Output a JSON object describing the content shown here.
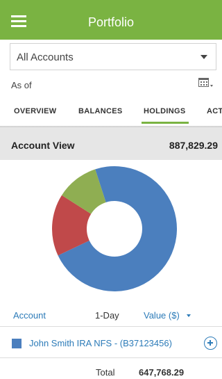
{
  "header": {
    "title": "Portfolio",
    "menu_icon": "hamburger-menu-icon"
  },
  "account_select": {
    "value": "All Accounts",
    "icon": "caret-down-icon"
  },
  "as_of": {
    "label": "As of",
    "icon": "calendar-icon"
  },
  "tabs": [
    {
      "label": "OVERVIEW",
      "active": false
    },
    {
      "label": "BALANCES",
      "active": false
    },
    {
      "label": "HOLDINGS",
      "active": true
    },
    {
      "label": "ACT",
      "active": false
    }
  ],
  "account_view": {
    "label": "Account View",
    "amount": "887,829.29"
  },
  "chart_data": {
    "type": "pie",
    "style": "donut",
    "segments": [
      {
        "share": 0.73,
        "color": "#4b7fbe"
      },
      {
        "share": 0.16,
        "color": "#c0494a"
      },
      {
        "share": 0.11,
        "color": "#8fae52"
      }
    ]
  },
  "columns": {
    "account": "Account",
    "one_day": "1-Day",
    "value": "Value ($)"
  },
  "rows": [
    {
      "name": "John Smith IRA NFS - (B37123456)",
      "color": "#4b7fbe",
      "icon": "plus-circle-icon"
    }
  ],
  "total": {
    "label": "Total",
    "value": "647,768.29"
  },
  "colors": {
    "brand_green": "#7ab342",
    "link_blue": "#2c7bb8"
  }
}
